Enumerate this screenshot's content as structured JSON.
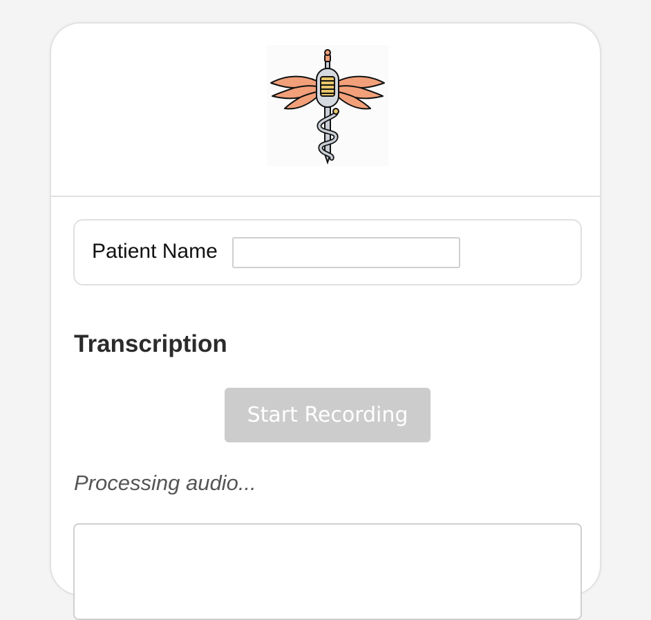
{
  "logo": {
    "icon": "caduceus-microphone-icon",
    "wing_color": "#f2a07a",
    "accent_color": "#e8c66a"
  },
  "patient": {
    "label": "Patient Name",
    "input_value": "",
    "input_placeholder": ""
  },
  "transcription": {
    "title": "Transcription",
    "record_button_label": "Start Recording",
    "status": "Processing audio...",
    "text": ""
  }
}
